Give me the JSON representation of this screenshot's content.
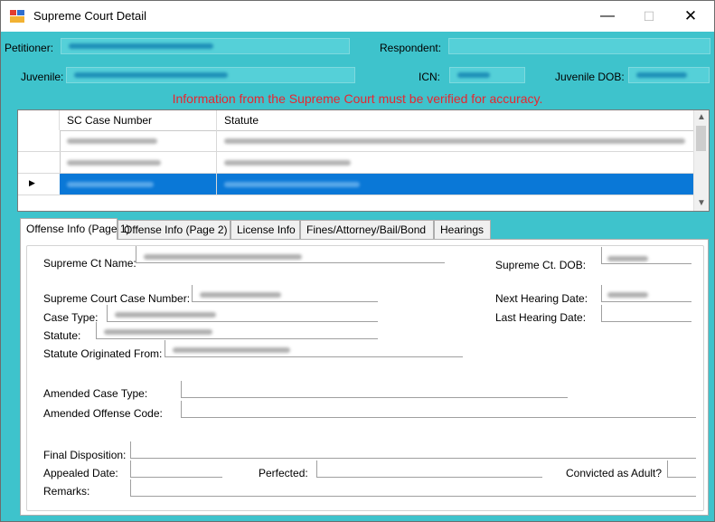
{
  "window": {
    "title": "Supreme Court Detail",
    "minimize_glyph": "—",
    "maximize_glyph": "☐",
    "close_glyph": "✕"
  },
  "header": {
    "petitioner_label": "Petitioner:",
    "respondent_label": "Respondent:",
    "juvenile_label": "Juvenile:",
    "icn_label": "ICN:",
    "juvenile_dob_label": "Juvenile DOB:",
    "warning": "Information from the Supreme Court must be verified for accuracy."
  },
  "grid": {
    "columns": [
      "SC Case Number",
      "Statute"
    ],
    "row_selector_glyph": "▶",
    "scroll_up_glyph": "▲",
    "scroll_down_glyph": "▼"
  },
  "tabs": [
    {
      "label": "Offense Info (Page 1)",
      "active": true
    },
    {
      "label": "Offense Info (Page 2)",
      "active": false
    },
    {
      "label": "License Info",
      "active": false
    },
    {
      "label": "Fines/Attorney/Bail/Bond",
      "active": false
    },
    {
      "label": "Hearings",
      "active": false
    }
  ],
  "offense_page1": {
    "supreme_ct_name_label": "Supreme Ct Name:",
    "supreme_ct_dob_label": "Supreme Ct. DOB:",
    "case_number_label": "Supreme Court Case Number:",
    "next_hearing_label": "Next Hearing Date:",
    "case_type_label": "Case Type:",
    "last_hearing_label": "Last Hearing Date:",
    "statute_label": "Statute:",
    "statute_origin_label": "Statute Originated From:",
    "amended_case_type_label": "Amended Case Type:",
    "amended_offense_code_label": "Amended Offense Code:",
    "final_disposition_label": "Final Disposition:",
    "appealed_date_label": "Appealed Date:",
    "perfected_label": "Perfected:",
    "convicted_adult_label": "Convicted as Adult?",
    "remarks_label": "Remarks:"
  },
  "colors": {
    "client_bg": "#3ec3cc",
    "warning_text": "#e8262f",
    "selection": "#0a78d7"
  }
}
